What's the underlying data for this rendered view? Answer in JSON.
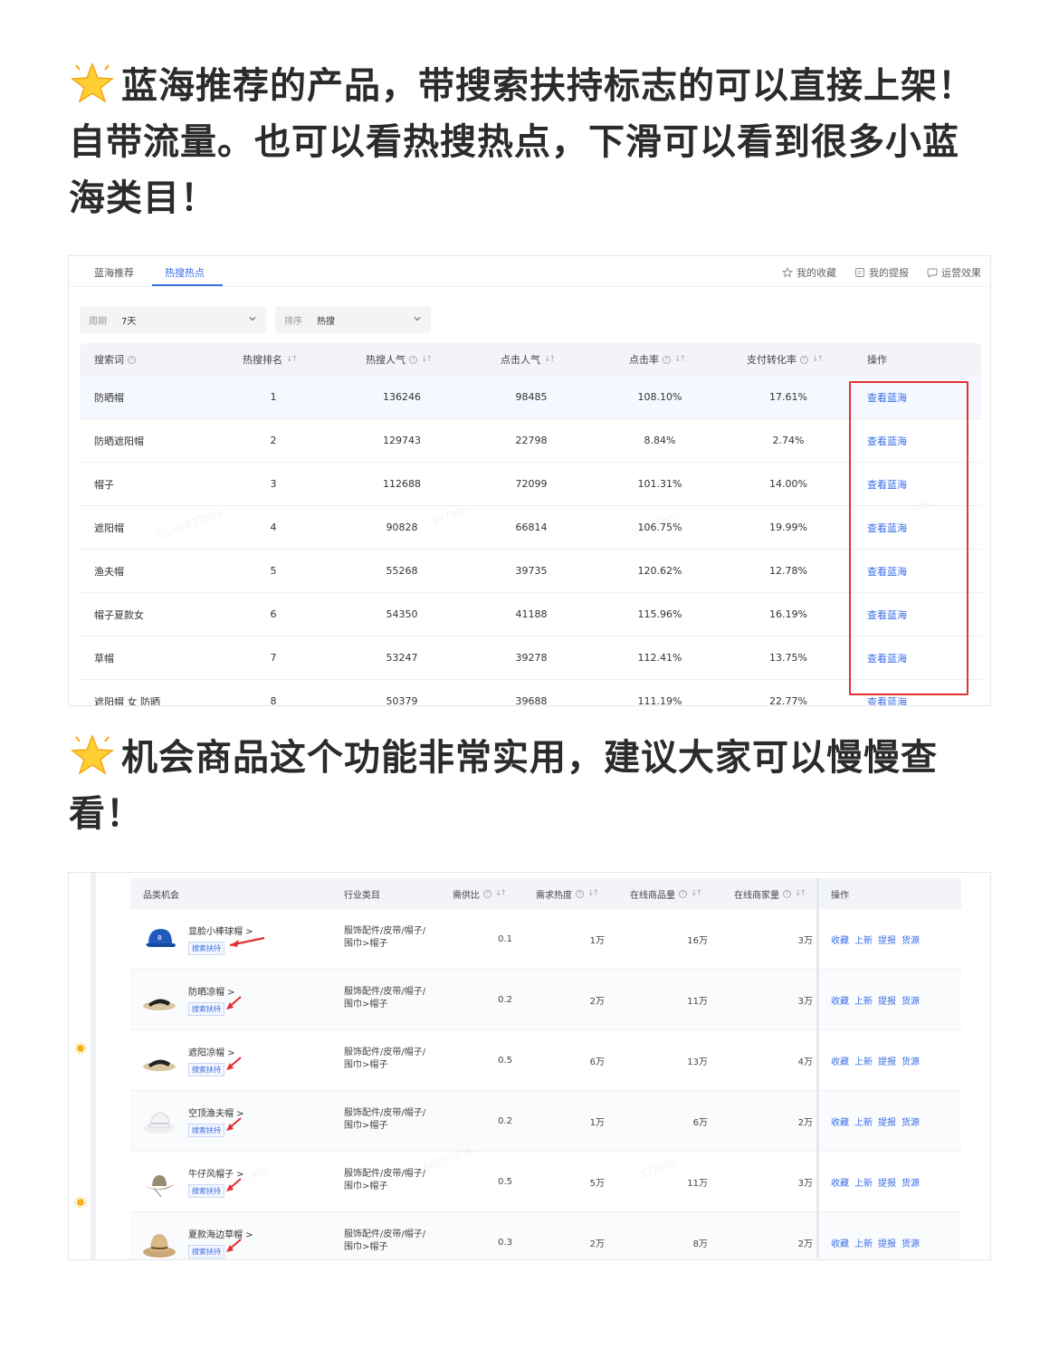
{
  "heading1": "蓝海推荐的产品，带搜索扶持标志的可以直接上架！自带流量。也可以看热搜热点，下滑可以看到很多小蓝海类目！",
  "heading2": "机会商品这个功能非常实用，建议大家可以慢慢查看！",
  "panel1": {
    "tabs": [
      {
        "label": "蓝海推荐",
        "active": false
      },
      {
        "label": "热搜热点",
        "active": true
      }
    ],
    "top_links": [
      {
        "label": "我的收藏",
        "icon": "star-outline-icon"
      },
      {
        "label": "我的提报",
        "icon": "report-icon"
      },
      {
        "label": "运营效果",
        "icon": "chat-icon"
      }
    ],
    "filters": [
      {
        "label": "周期",
        "value": "7天"
      },
      {
        "label": "排序",
        "value": "热搜"
      }
    ],
    "columns": [
      "搜索词",
      "热搜排名",
      "热搜人气",
      "点击人气",
      "点击率",
      "支付转化率",
      "操作"
    ],
    "rows": [
      {
        "keyword": "防晒帽",
        "rank": "1",
        "popularity": "136246",
        "clicks": "98485",
        "ctr": "108.10%",
        "conversion": "17.61%",
        "action": "查看蓝海"
      },
      {
        "keyword": "防晒遮阳帽",
        "rank": "2",
        "popularity": "129743",
        "clicks": "22798",
        "ctr": "8.84%",
        "conversion": "2.74%",
        "action": "查看蓝海"
      },
      {
        "keyword": "帽子",
        "rank": "3",
        "popularity": "112688",
        "clicks": "72099",
        "ctr": "101.31%",
        "conversion": "14.00%",
        "action": "查看蓝海"
      },
      {
        "keyword": "遮阳帽",
        "rank": "4",
        "popularity": "90828",
        "clicks": "66814",
        "ctr": "106.75%",
        "conversion": "19.99%",
        "action": "查看蓝海"
      },
      {
        "keyword": "渔夫帽",
        "rank": "5",
        "popularity": "55268",
        "clicks": "39735",
        "ctr": "120.62%",
        "conversion": "12.78%",
        "action": "查看蓝海"
      },
      {
        "keyword": "帽子夏款女",
        "rank": "6",
        "popularity": "54350",
        "clicks": "41188",
        "ctr": "115.96%",
        "conversion": "16.19%",
        "action": "查看蓝海"
      },
      {
        "keyword": "草帽",
        "rank": "7",
        "popularity": "53247",
        "clicks": "39278",
        "ctr": "112.41%",
        "conversion": "13.75%",
        "action": "查看蓝海"
      },
      {
        "keyword": "遮阳帽 女 防晒",
        "rank": "8",
        "popularity": "50379",
        "clicks": "39688",
        "ctr": "111.19%",
        "conversion": "22.77%",
        "action": "查看蓝海"
      }
    ]
  },
  "panel2": {
    "columns": [
      "品类机会",
      "行业类目",
      "需供比",
      "需求热度",
      "在线商品量",
      "在线商家量",
      "操作"
    ],
    "actions": [
      "收藏",
      "上新",
      "提报",
      "货源"
    ],
    "tag_label": "搜索扶持",
    "rows": [
      {
        "name": "显脸小棒球帽 >",
        "industry": "服饰配件/皮带/帽子/围巾>帽子",
        "ratio": "0.1",
        "heat": "1万",
        "online_items": "16万",
        "merchants": "3万",
        "image": "baseball-cap-icon"
      },
      {
        "name": "防晒凉帽 >",
        "industry": "服饰配件/皮带/帽子/围巾>帽子",
        "ratio": "0.2",
        "heat": "2万",
        "online_items": "11万",
        "merchants": "3万",
        "image": "visor-hat-icon"
      },
      {
        "name": "遮阳凉帽 >",
        "industry": "服饰配件/皮带/帽子/围巾>帽子",
        "ratio": "0.5",
        "heat": "6万",
        "online_items": "13万",
        "merchants": "4万",
        "image": "visor-hat-icon"
      },
      {
        "name": "空顶渔夫帽 >",
        "industry": "服饰配件/皮带/帽子/围巾>帽子",
        "ratio": "0.2",
        "heat": "1万",
        "online_items": "6万",
        "merchants": "2万",
        "image": "bucket-hat-icon"
      },
      {
        "name": "牛仔风帽子 >",
        "industry": "服饰配件/皮带/帽子/围巾>帽子",
        "ratio": "0.5",
        "heat": "5万",
        "online_items": "11万",
        "merchants": "3万",
        "image": "cowboy-hat-icon"
      },
      {
        "name": "夏款海边草帽 >",
        "industry": "服饰配件/皮带/帽子/围巾>帽子",
        "ratio": "0.3",
        "heat": "2万",
        "online_items": "8万",
        "merchants": "2万",
        "image": "straw-hat-icon"
      }
    ]
  },
  "colors": {
    "accent": "#3a6ee8",
    "highlight": "#e03030"
  }
}
